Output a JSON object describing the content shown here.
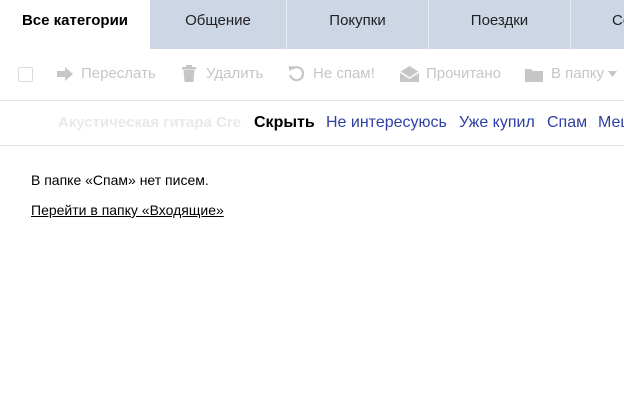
{
  "tabs": [
    {
      "label": "Все категории",
      "active": true
    },
    {
      "label": "Общение"
    },
    {
      "label": "Покупки"
    },
    {
      "label": "Поездки"
    },
    {
      "label": "Сообщения"
    }
  ],
  "toolbar": {
    "forward": {
      "label": "Переслать",
      "icon": "forward-arrow-icon"
    },
    "delete": {
      "label": "Удалить",
      "icon": "trash-icon"
    },
    "not_spam": {
      "label": "Не спам!",
      "icon": "undo-icon"
    },
    "read": {
      "label": "Прочитано",
      "icon": "open-envelope-icon"
    },
    "to_folder": {
      "label": "В папку",
      "icon": "folder-icon",
      "dropdown_icon": "caret-down-icon"
    }
  },
  "suggestions": {
    "background_text": "Акустическая гитара Cre",
    "hide": "Скрыть",
    "links": [
      "Не интересуюсь",
      "Уже купил",
      "Спам",
      "Мешает"
    ]
  },
  "content": {
    "empty_message": "В папке «Спам» нет писем.",
    "inbox_link": "Перейти в папку «Входящие»"
  },
  "colors": {
    "tab_bar": "#ccd6e4",
    "disabled_text": "#c6c6c6",
    "link_blue": "#2f3fa3"
  }
}
